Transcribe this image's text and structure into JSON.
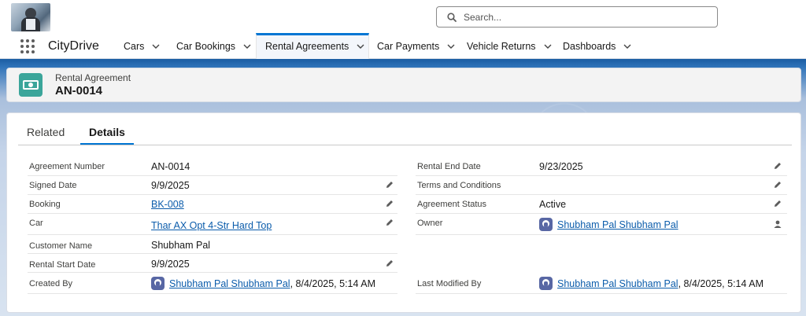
{
  "header": {
    "search_placeholder": "Search..."
  },
  "nav": {
    "app_name": "CityDrive",
    "items": [
      {
        "label": "Cars"
      },
      {
        "label": "Car Bookings"
      },
      {
        "label": "Rental Agreements",
        "active": true
      },
      {
        "label": "Car Payments"
      },
      {
        "label": "Vehicle Returns"
      },
      {
        "label": "Dashboards"
      }
    ]
  },
  "record": {
    "type": "Rental Agreement",
    "title": "AN-0014"
  },
  "tabs": {
    "related": "Related",
    "details": "Details"
  },
  "fields": {
    "agreement_number": {
      "label": "Agreement Number",
      "value": "AN-0014"
    },
    "signed_date": {
      "label": "Signed Date",
      "value": "9/9/2025"
    },
    "booking": {
      "label": "Booking",
      "value": "BK-008"
    },
    "car": {
      "label": "Car",
      "value": "Thar AX Opt 4-Str Hard Top"
    },
    "customer_name": {
      "label": "Customer Name",
      "value": "Shubham Pal"
    },
    "rental_start_date": {
      "label": "Rental Start Date",
      "value": "9/9/2025"
    },
    "created_by": {
      "label": "Created By",
      "user": "Shubham Pal Shubham Pal",
      "date": ", 8/4/2025, 5:14 AM"
    },
    "rental_end_date": {
      "label": "Rental End Date",
      "value": "9/23/2025"
    },
    "terms": {
      "label": "Terms and Conditions",
      "value": ""
    },
    "agreement_status": {
      "label": "Agreement Status",
      "value": "Active"
    },
    "owner": {
      "label": "Owner",
      "value": "Shubham Pal Shubham Pal"
    },
    "last_modified_by": {
      "label": "Last Modified By",
      "user": "Shubham Pal Shubham Pal",
      "date": ", 8/4/2025, 5:14 AM"
    }
  },
  "colors": {
    "accent": "#0176d3",
    "link": "#0b5cab",
    "record_icon": "#3ba59a"
  }
}
